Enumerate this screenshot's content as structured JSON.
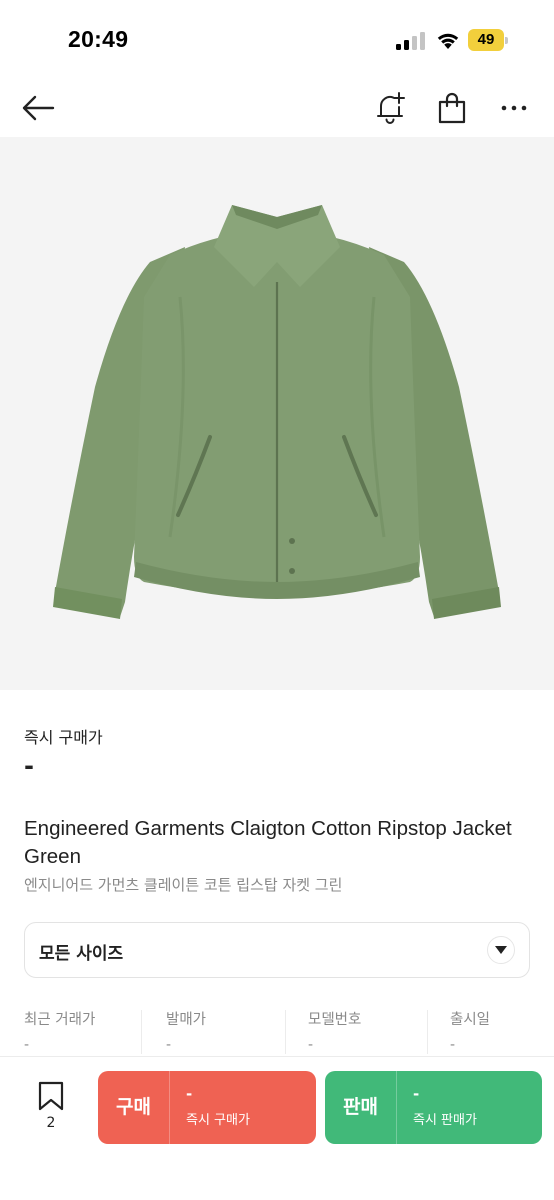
{
  "status_bar": {
    "time": "20:49",
    "battery": "49"
  },
  "nav": {
    "back_icon": "arrow-left-icon",
    "alert_icon": "bell-plus-icon",
    "bag_icon": "shopping-bag-icon",
    "more_icon": "more-horizontal-icon"
  },
  "product": {
    "image_subject": "olive green zip jacket",
    "instant_price_label": "즉시 구매가",
    "instant_price_value": "-",
    "title_en": "Engineered Garments Claigton Cotton Ripstop Jacket Green",
    "title_ko": "엔지니어드 가먼츠 클레이튼 코튼 립스탑 자켓 그린"
  },
  "size_select": {
    "label": "모든 사이즈"
  },
  "stats": [
    {
      "label": "최근 거래가",
      "value": "-"
    },
    {
      "label": "발매가",
      "value": "-"
    },
    {
      "label": "모델번호",
      "value": "-"
    },
    {
      "label": "출시일",
      "value": "-"
    }
  ],
  "bottom_bar": {
    "wish_count": "2",
    "buy": {
      "label": "구매",
      "price": "-",
      "sub": "즉시 구매가"
    },
    "sell": {
      "label": "판매",
      "price": "-",
      "sub": "즉시 판매가"
    }
  },
  "colors": {
    "buy": "#ef6253",
    "sell": "#41b979",
    "jacket": "#7f9a6e",
    "battery": "#f2cf3c"
  }
}
